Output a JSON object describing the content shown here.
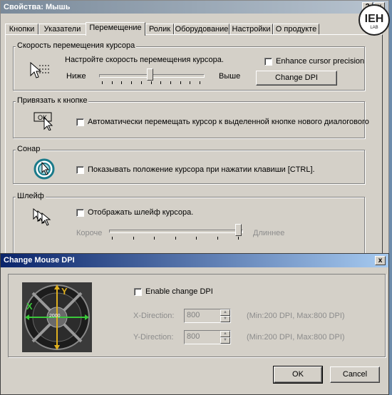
{
  "mouse_window": {
    "title": "Свойства: Мышь",
    "help_button": "?",
    "close_button": "x",
    "tabs": [
      {
        "label": "Кнопки"
      },
      {
        "label": "Указатели"
      },
      {
        "label": "Перемещение"
      },
      {
        "label": "Ролик"
      },
      {
        "label": "Оборудование"
      },
      {
        "label": "Настройки"
      },
      {
        "label": "О продукте"
      }
    ],
    "active_tab": "Перемещение",
    "speed_group": {
      "legend": "Скорость перемещения курсора",
      "instruction": "Настройте скорость перемещения курсора.",
      "slow_label": "Ниже",
      "fast_label": "Выше",
      "slider_fraction": 0.49,
      "enhance_checkbox_label": "Enhance cursor precision",
      "enhance_checked": false,
      "change_dpi_button": "Change DPI"
    },
    "snap_group": {
      "legend": "Привязать к кнопке",
      "ok_icon_text": "OK",
      "checkbox_label": "Автоматически перемещать курсор к выделенной кнопке нового диалогового",
      "checked": false
    },
    "sonar_group": {
      "legend": "Сонар",
      "checkbox_label": "Показывать положение курсора при нажатии клавиши [CTRL].",
      "checked": false
    },
    "trail_group": {
      "legend": "Шлейф",
      "checkbox_label": "Отображать шлейф курсора.",
      "checked": false,
      "short_label": "Короче",
      "long_label": "Длиннее",
      "slider_fraction": 1.0
    }
  },
  "dpi_window": {
    "title": "Change Mouse DPI",
    "close_button": "x",
    "image_labels": {
      "x": "X",
      "y": "Y",
      "center": "2000"
    },
    "enable_label": "Enable change DPI",
    "enable_checked": false,
    "x_label": "X-Direction:",
    "x_value": "800",
    "x_range": "(Min:200 DPI, Max:800 DPI)",
    "y_label": "Y-Direction:",
    "y_value": "800",
    "y_range": "(Min:200 DPI, Max:800 DPI)",
    "ok_button": "OK",
    "cancel_button": "Cancel"
  },
  "watermark": {
    "text": "IEH",
    "sub": "LAB"
  }
}
